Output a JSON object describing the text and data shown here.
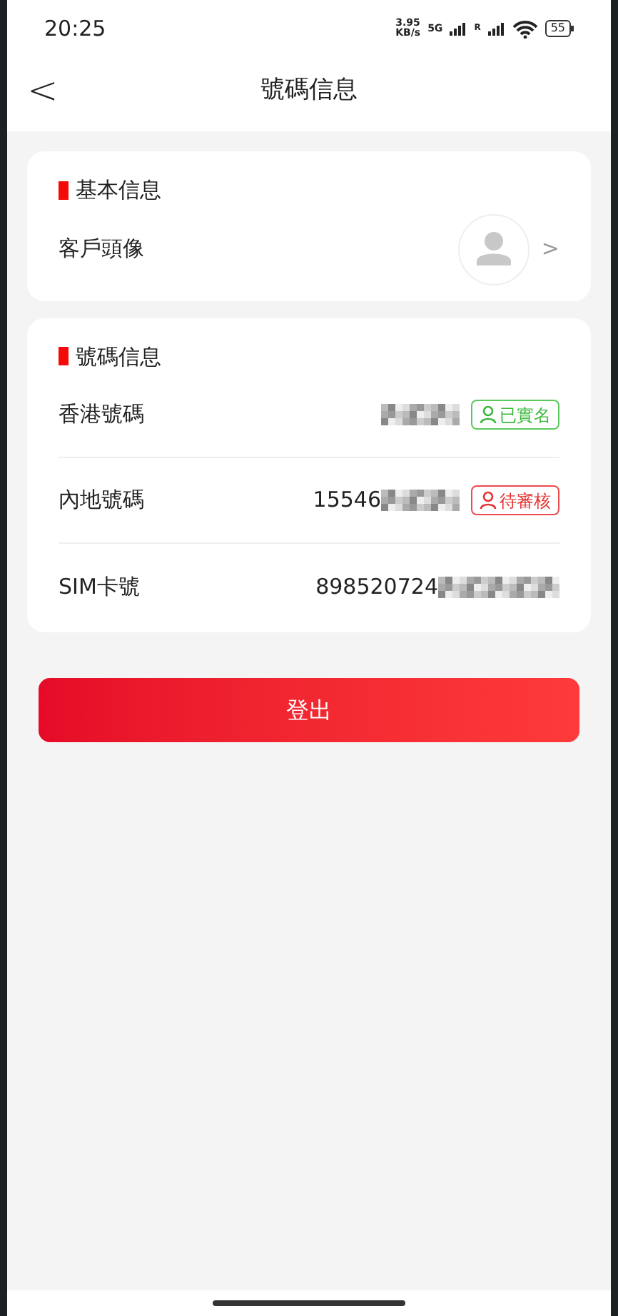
{
  "status_bar": {
    "time": "20:25",
    "speed": "3.95",
    "speed_unit": "KB/s",
    "network": "5G",
    "roaming": "R",
    "battery": "55"
  },
  "header": {
    "back": "<",
    "title": "號碼信息"
  },
  "basic_section": {
    "title": "基本信息",
    "rows": [
      {
        "label": "客戶頭像",
        "chevron": ">"
      }
    ]
  },
  "number_section": {
    "title": "號碼信息",
    "rows": [
      {
        "label": "香港號碼",
        "redacted": true,
        "badge": {
          "text": "已實名",
          "kind": "verified"
        }
      },
      {
        "label": "內地號碼",
        "value": "15546",
        "redacted": true,
        "badge": {
          "text": "待審核",
          "kind": "pending"
        }
      },
      {
        "label": "SIM卡號",
        "value": "898520724",
        "redacted": true
      }
    ]
  },
  "logout_button": "登出"
}
